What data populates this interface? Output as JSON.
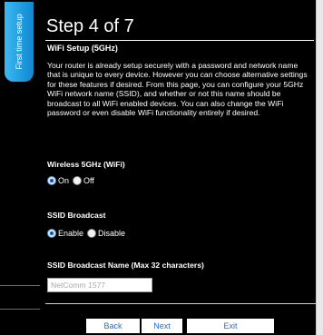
{
  "sidebar": {
    "tab_label": "First time setup"
  },
  "header": {
    "title": "Step 4 of 7",
    "subtitle": "WiFi Setup (5GHz)"
  },
  "description": "Your router is already setup securely with a password and network name that is unique to every device. However you can choose alternative settings for these features if desired. From this page, you can configure your 5GHz WiFi network name (SSID), and whether or not this name should be broadcast to all WiFi enabled devices. You can also change the WiFi password or even disable WiFi functionality entirely if desired.",
  "wireless": {
    "label": "Wireless 5GHz (WiFi)",
    "options": [
      "On",
      "Off"
    ],
    "selected": "On"
  },
  "ssid_broadcast": {
    "label": "SSID Broadcast",
    "options": [
      "Enable",
      "Disable"
    ],
    "selected": "Enable"
  },
  "ssid_name": {
    "label": "SSID Broadcast Name (Max 32 characters)",
    "value": "NetComm 1577"
  },
  "buttons": {
    "back": "Back",
    "next": "Next",
    "exit": "Exit"
  },
  "colors": {
    "background": "#000000",
    "tab_blue": "#1e9be0",
    "button_text": "#2a6ad0"
  }
}
